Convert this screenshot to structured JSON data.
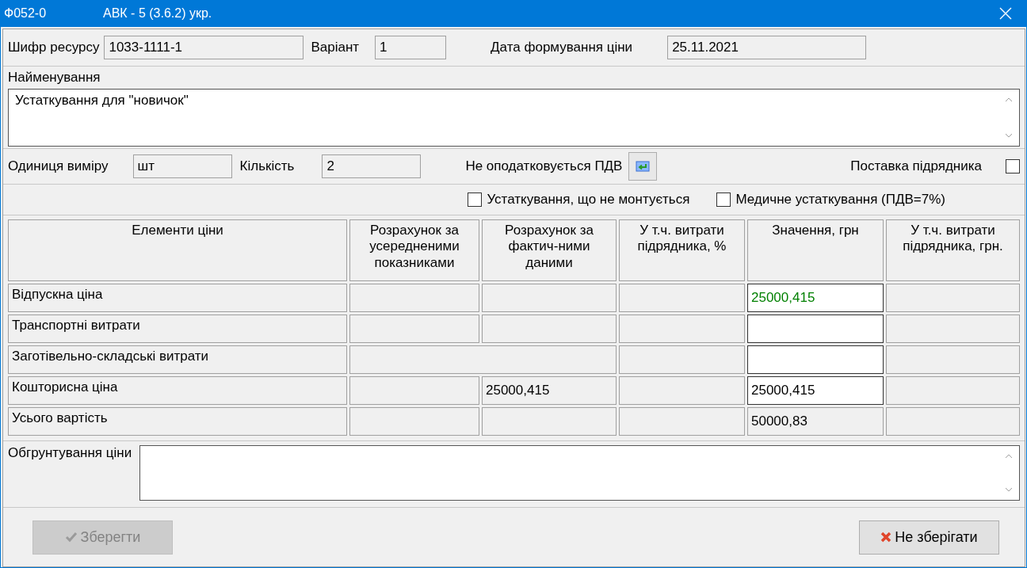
{
  "window": {
    "title_code": "Ф052-0",
    "title": "АВК - 5 (3.6.2) укр."
  },
  "resource": {
    "code_label": "Шифр ресурсу",
    "code": "1033-1111-1",
    "variant_label": "Варіант",
    "variant": "1",
    "date_label": "Дата формування ціни",
    "date": "25.11.2021"
  },
  "name": {
    "label": "Найменування",
    "value": "Устаткування для \"новичок\""
  },
  "units": {
    "unit_label": "Одиниця виміру",
    "unit": "шт",
    "qty_label": "Кількість",
    "qty": "2",
    "vat_label": "Не оподатковується ПДВ",
    "contractor_label": "Поставка підрядника",
    "contractor_checked": false
  },
  "options": [
    {
      "label": "Устаткування, що не монтується",
      "checked": false
    },
    {
      "label": "Медичне устаткування (ПДВ=7%)",
      "checked": false
    }
  ],
  "table": {
    "columns": [
      "Елементи ціни",
      "Розрахунок за усередненими показниками",
      "Розрахунок за фактич-ними даними",
      "У т.ч. витрати підрядника, %",
      "Значення, грн",
      "У т.ч. витрати підрядника, грн."
    ],
    "rows": [
      {
        "cells": [
          {
            "kind": "label",
            "value": "Відпускна ціна"
          },
          {
            "kind": "readonly"
          },
          {
            "kind": "readonly"
          },
          {
            "kind": "readonly"
          },
          {
            "kind": "input",
            "value": "25000,415",
            "color": "#008000"
          },
          {
            "kind": "readonly"
          }
        ]
      },
      {
        "cells": [
          {
            "kind": "label",
            "value": "Транспортні витрати"
          },
          {
            "kind": "readonly"
          },
          {
            "kind": "readonly"
          },
          {
            "kind": "readonly"
          },
          {
            "kind": "input"
          },
          {
            "kind": "readonly"
          }
        ]
      },
      {
        "cells": [
          {
            "kind": "label",
            "value": "Заготівельно-складські витрати"
          },
          {
            "kind": "wide"
          },
          {
            "kind": "readonly"
          },
          {
            "kind": "input"
          },
          {
            "kind": "readonly"
          }
        ]
      },
      {
        "cells": [
          {
            "kind": "label",
            "value": "Кошторисна ціна"
          },
          {
            "kind": "readonly"
          },
          {
            "kind": "readonly",
            "value": "25000,415"
          },
          {
            "kind": "readonly"
          },
          {
            "kind": "input",
            "value": "25000,415"
          },
          {
            "kind": "readonly"
          }
        ]
      },
      {
        "cells": [
          {
            "kind": "label",
            "value": "Усього вартість"
          },
          {
            "kind": "readonly"
          },
          {
            "kind": "readonly"
          },
          {
            "kind": "readonly"
          },
          {
            "kind": "readonly",
            "value": "50000,83"
          },
          {
            "kind": "readonly"
          }
        ]
      }
    ]
  },
  "justification": {
    "label": "Обгрунтування ціни"
  },
  "buttons": [
    {
      "kind": "save",
      "label": "Зберегти",
      "disabled": true
    },
    {
      "kind": "cancel",
      "label": "Не зберігати",
      "disabled": false
    }
  ]
}
